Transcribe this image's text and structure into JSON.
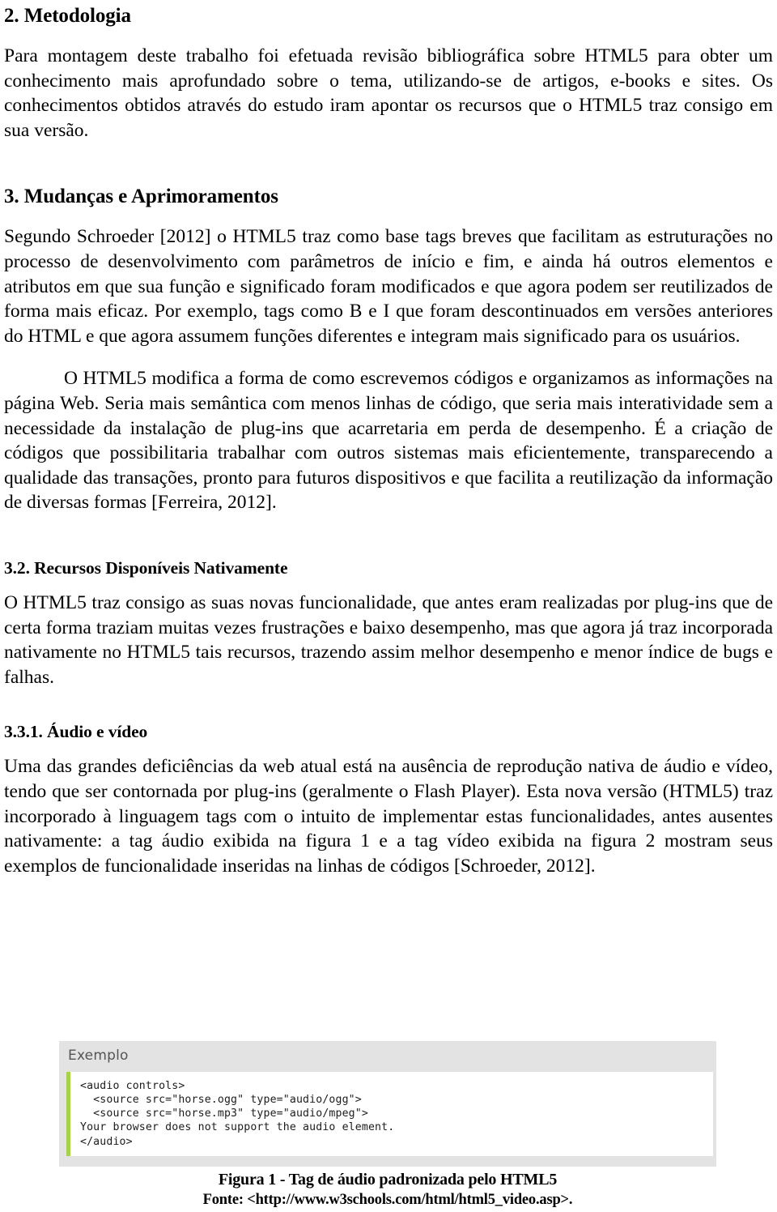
{
  "document": {
    "language": "pt-BR",
    "sections": [
      {
        "id": "metodologia",
        "heading": "2. Metodologia",
        "paragraphs": [
          "Para montagem deste trabalho foi efetuada revisão bibliográfica sobre HTML5 para obter um conhecimento mais aprofundado sobre o tema, utilizando-se de artigos, e-books e sites. Os conhecimentos obtidos através do estudo iram apontar os recursos que o HTML5 traz consigo em sua versão."
        ]
      },
      {
        "id": "mudancas-aprimoramentos",
        "heading": "3. Mudanças e Aprimoramentos",
        "paragraphs": [
          "Segundo Schroeder [2012] o HTML5 traz como base tags breves que facilitam as estruturações no processo de desenvolvimento com parâmetros de início e fim, e ainda há outros elementos e atributos em que sua função e significado foram modificados e que agora podem ser reutilizados de forma mais eficaz. Por exemplo, tags como B e I que foram descontinuados em versões anteriores do HTML e que agora assumem funções diferentes e integram mais significado para os usuários.",
          "O HTML5 modifica a forma de como escrevemos códigos e organizamos as informações na página Web. Seria mais semântica com menos linhas de código, que seria mais interatividade sem a necessidade da instalação de plug-ins que acarretaria em perda de desempenho. É a criação de códigos que possibilitaria trabalhar com outros sistemas mais eficientemente, transparecendo a qualidade das transações, pronto para futuros dispositivos e que facilita a reutilização da informação de diversas formas [Ferreira, 2012]."
        ]
      },
      {
        "id": "recursos-nativos",
        "heading": "3.2. Recursos Disponíveis Nativamente",
        "paragraphs": [
          "O HTML5 traz consigo as suas novas funcionalidade, que antes eram realizadas por plug-ins que de certa forma traziam muitas vezes frustrações e baixo desempenho, mas que agora já traz incorporada nativamente no HTML5 tais recursos, trazendo assim melhor desempenho e menor índice de bugs e falhas."
        ]
      },
      {
        "id": "audio-video",
        "heading": "3.3.1. Áudio e vídeo",
        "paragraphs": [
          "Uma das grandes deficiências da web atual está na ausência de reprodução nativa de áudio e vídeo, tendo que ser contornada por plug-ins (geralmente o Flash Player). Esta nova versão (HTML5) traz incorporado à linguagem tags com o intuito de implementar estas funcionalidades, antes ausentes nativamente: a tag áudio exibida na figura 1 e a tag vídeo exibida na figura 2 mostram seus exemplos de funcionalidade inseridas na linhas de códigos [Schroeder, 2012]."
        ]
      }
    ]
  },
  "figure": {
    "panel_title": "Exemplo",
    "code": "<audio controls>\n  <source src=\"horse.ogg\" type=\"audio/ogg\">\n  <source src=\"horse.mp3\" type=\"audio/mpeg\">\nYour browser does not support the audio element.\n</audio>",
    "caption_title": "Figura 1 - Tag de áudio padronizada pelo HTML5",
    "caption_source": "Fonte: <http://www.w3schools.com/html/html5_video.asp>.",
    "colors": {
      "panel_background": "#e3e3e3",
      "code_background": "#ffffff",
      "accent_bar": "#a5d44a",
      "panel_title_text": "#555555",
      "code_text": "#1c1c1c"
    }
  }
}
